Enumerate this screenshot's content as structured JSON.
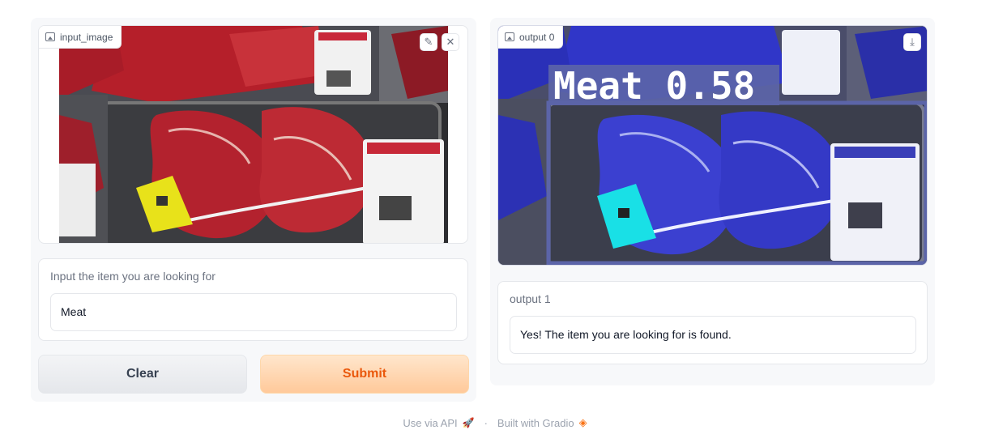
{
  "input": {
    "image_label": "input_image",
    "edit_icon": "pencil-icon",
    "clear_icon": "close-icon",
    "text_label": "Input the item you are looking for",
    "text_value": "Meat"
  },
  "buttons": {
    "clear_label": "Clear",
    "submit_label": "Submit"
  },
  "output": {
    "image_label": "output 0",
    "download_icon": "download-icon",
    "detection_label": "Meat 0.58",
    "text_label": "output 1",
    "text_value": "Yes! The item you are looking for is found."
  },
  "footer": {
    "api_label": "Use via API",
    "separator": "·",
    "built_with": "Built with Gradio"
  },
  "colors": {
    "submit_text": "#ea580c",
    "detection_box": "#5b64a8"
  }
}
